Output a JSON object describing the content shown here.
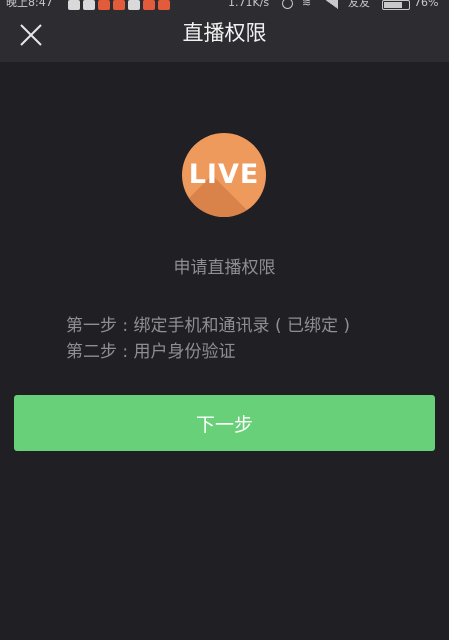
{
  "status_bar": {
    "time": "晚上8:47",
    "network_speed": "1.71K/s",
    "carrier": "友友",
    "battery_percent": "76%",
    "battery_level": 0.76
  },
  "nav": {
    "title": "直播权限",
    "close_icon": "close-icon"
  },
  "logo": {
    "text": "LIVE",
    "color": "#ef9a5d"
  },
  "main": {
    "subtitle": "申请直播权限",
    "steps": [
      "第一步 : 绑定手机和通讯录 ( 已绑定 )",
      "第二步 : 用户身份验证"
    ]
  },
  "actions": {
    "next_label": "下一步",
    "next_color": "#67d079"
  }
}
